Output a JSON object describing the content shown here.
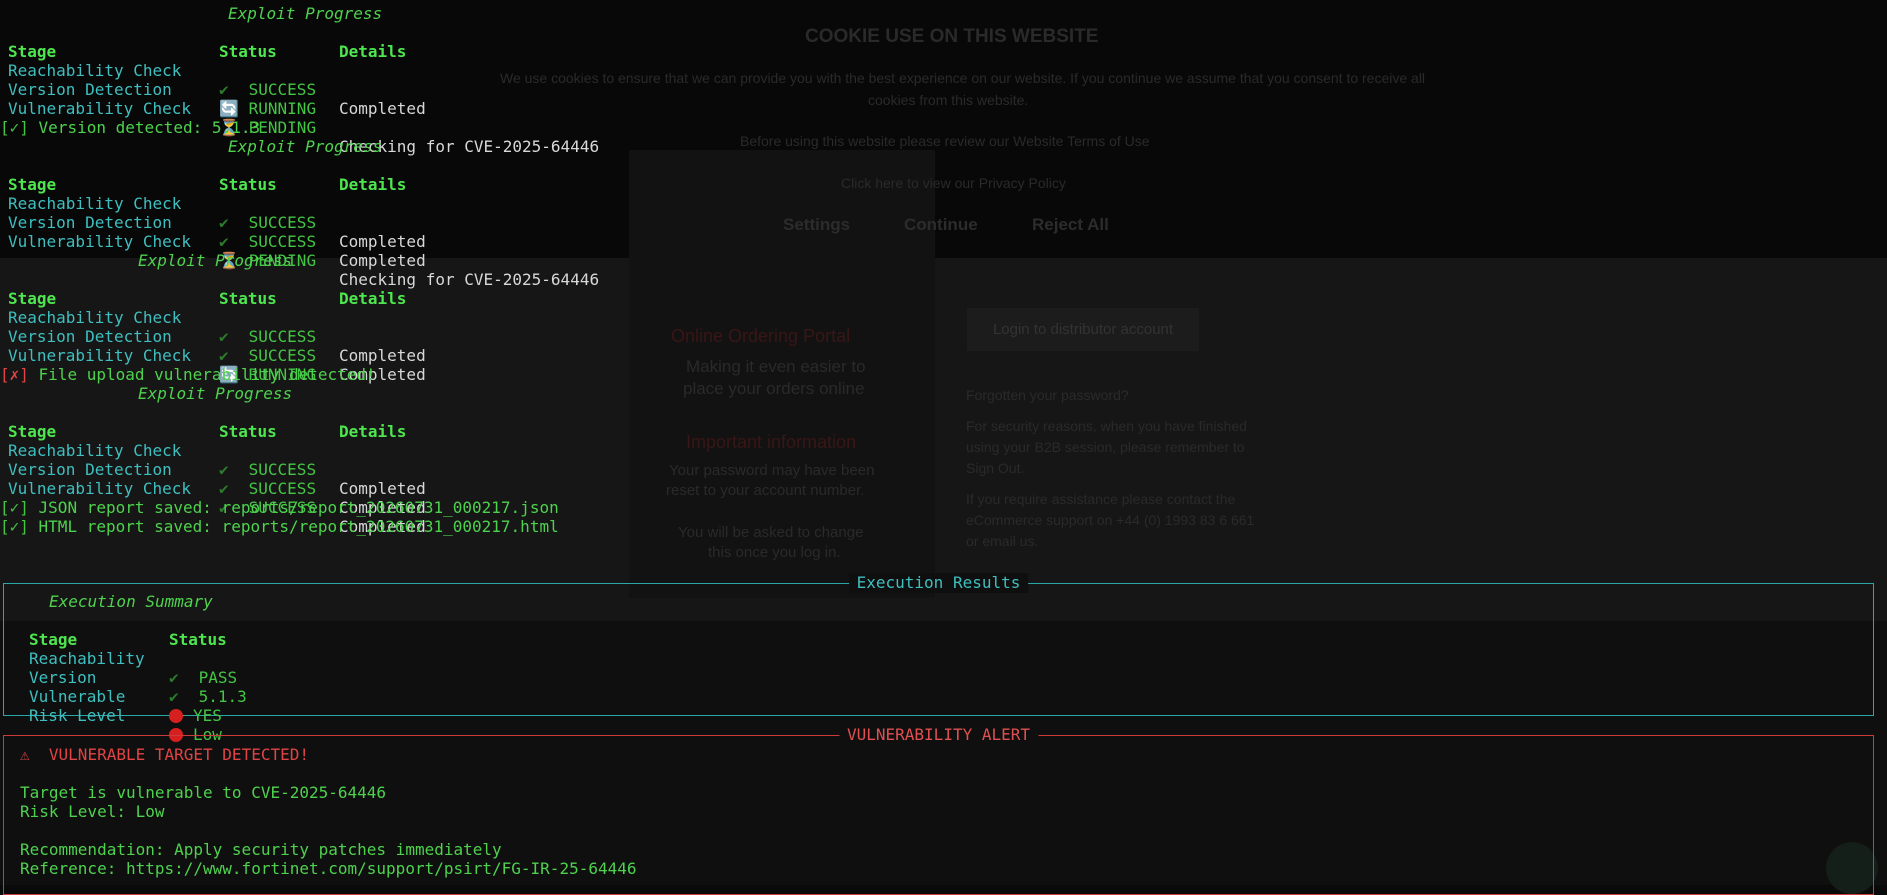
{
  "background_site": {
    "cookie_title": "COOKIE USE ON THIS WEBSITE",
    "cookie_text_1": "We use cookies to ensure that we can provide you with the best experience on our website. If you continue we assume that you consent to receive all",
    "cookie_text_2": "cookies from this website.",
    "terms_text": "Before using this website please review our  Website Terms of Use",
    "privacy_text": "Click here to view our Privacy Policy",
    "settings_label": "Settings",
    "continue_label": "Continue",
    "reject_label": "Reject All",
    "online_title": "Online Ordering Portal",
    "online_sub_1": "Making it even easier to",
    "online_sub_2": "place your orders online",
    "important_title": "Important information",
    "password_text_1": "Your password may have been",
    "password_text_2": "reset to your account number.",
    "change_text_1": "You will be asked to change",
    "change_text_2": "this once you log in.",
    "login_label": "Login to distributor account",
    "forgot_label": "Forgotten your password?",
    "security_1": "For security reasons, when you have finished",
    "security_2": "using your B2B session, please remember to",
    "security_3": "Sign Out.",
    "help_1": "If you require assistance please contact the",
    "help_2": "eCommerce support on +44 (0) 1993 83 6 661",
    "help_3": "or email us."
  },
  "icons": {
    "success": "check-mark-icon",
    "pending": "hourglass-icon",
    "running": "refresh-icon",
    "high_risk": "red-circle-icon",
    "warning": "warning-icon"
  },
  "progress_table_title": "Exploit Progress",
  "columns": {
    "stage": "Stage",
    "status": "Status",
    "details": "Details"
  },
  "blocks": [
    {
      "rows": [
        {
          "stage": "Reachability Check",
          "icon": "✔",
          "status": "SUCCESS",
          "details": "Completed"
        },
        {
          "stage": "Version Detection",
          "icon": "🔄",
          "status": "RUNNING",
          "details": ""
        },
        {
          "stage": "Vulnerability Check",
          "icon": "⏳",
          "status": "PENDING",
          "details": "Checking for CVE-2025-64446"
        }
      ]
    },
    {
      "rows": [
        {
          "stage": "Reachability Check",
          "icon": "✔",
          "status": "SUCCESS",
          "details": "Completed"
        },
        {
          "stage": "Version Detection",
          "icon": "✔",
          "status": "SUCCESS",
          "details": "Completed"
        },
        {
          "stage": "Vulnerability Check",
          "icon": "⏳",
          "status": "PENDING",
          "details": "Checking for CVE-2025-64446"
        }
      ]
    },
    {
      "rows": [
        {
          "stage": "Reachability Check",
          "icon": "✔",
          "status": "SUCCESS",
          "details": "Completed"
        },
        {
          "stage": "Version Detection",
          "icon": "✔",
          "status": "SUCCESS",
          "details": "Completed"
        },
        {
          "stage": "Vulnerability Check",
          "icon": "🔄",
          "status": "RUNNING",
          "details": ""
        }
      ]
    },
    {
      "rows": [
        {
          "stage": "Reachability Check",
          "icon": "✔",
          "status": "SUCCESS",
          "details": "Completed"
        },
        {
          "stage": "Version Detection",
          "icon": "✔",
          "status": "SUCCESS",
          "details": "Completed"
        },
        {
          "stage": "Vulnerability Check",
          "icon": "✔",
          "status": "SUCCESS",
          "details": "Completed"
        }
      ]
    }
  ],
  "messages": {
    "version_detected": {
      "mark": "[✓]",
      "text": " Version detected: 5.1.3"
    },
    "file_upload": {
      "mark": "[✗]",
      "text": " File upload vulnerability detected!"
    },
    "json_report": {
      "mark": "[✓]",
      "text": " JSON report saved: reports/report_20260731_000217.json"
    },
    "html_report": {
      "mark": "[✓]",
      "text": " HTML report saved: reports/report_20260731_000217.html"
    }
  },
  "execution_results": {
    "panel_title": "Execution Results",
    "table_title": "Execution Summary",
    "col_stage": "Stage",
    "col_status": "Status",
    "rows": [
      {
        "stage": "Reachability",
        "icon": "✔",
        "value": "PASS"
      },
      {
        "stage": "Version",
        "icon": "✔",
        "value": "5.1.3"
      },
      {
        "stage": "Vulnerable",
        "icon": "dot",
        "value": "YES"
      },
      {
        "stage": "Risk Level",
        "icon": "dot",
        "value": "Low"
      }
    ]
  },
  "vulnerability_alert": {
    "panel_title": "VULNERABILITY ALERT",
    "warning_icon": "⚠",
    "headline": "VULNERABLE TARGET DETECTED!",
    "target_line": "Target is vulnerable to CVE-2025-64446",
    "risk_line": "Risk Level: Low",
    "recommendation": "Recommendation: Apply security patches immediately",
    "reference": "Reference: https://www.fortinet.com/support/psirt/FG-IR-25-64446"
  },
  "colors": {
    "green": "#4ed24e",
    "cyan": "#3fbfbf",
    "red": "#e04444",
    "yellow": "#e0c040",
    "background": "#0a0a0a"
  }
}
